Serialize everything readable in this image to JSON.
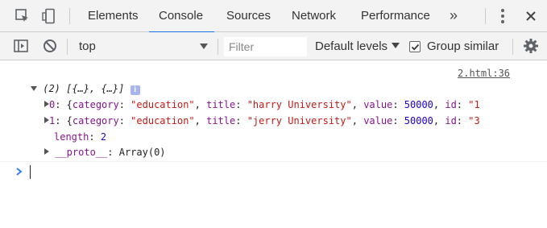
{
  "tabbar": {
    "icons": [
      "inspect-element-icon",
      "device-toolbar-icon"
    ],
    "tabs": [
      {
        "label": "Elements"
      },
      {
        "label": "Console",
        "active": true
      },
      {
        "label": "Sources"
      },
      {
        "label": "Network"
      },
      {
        "label": "Performance"
      }
    ],
    "more_label": "»",
    "menu_icon": "more-vertical-icon",
    "close_icon": "close-icon"
  },
  "toolbar": {
    "context": "top",
    "filter_placeholder": "Filter",
    "levels_label": "Default levels",
    "group_similar_label": "Group similar",
    "group_similar_checked": true
  },
  "console": {
    "source_link": "2.html:36",
    "array_summary": "(2) [{…}, {…}]",
    "info_badge": "i",
    "items": [
      {
        "index": "0",
        "category": "\"education\"",
        "title": "\"harry University\"",
        "value": "50000",
        "id": "\"1"
      },
      {
        "index": "1",
        "category": "\"education\"",
        "title": "\"jerry University\"",
        "value": "50000",
        "id": "\"3"
      }
    ],
    "length_label": "length",
    "length_value": "2",
    "proto_label": "__proto__",
    "proto_value": "Array(0)"
  },
  "colors": {
    "accent": "#1a73e8",
    "key": "#881391",
    "string": "#c41a16",
    "number": "#1c00cf",
    "prompt": "#367cf1"
  }
}
